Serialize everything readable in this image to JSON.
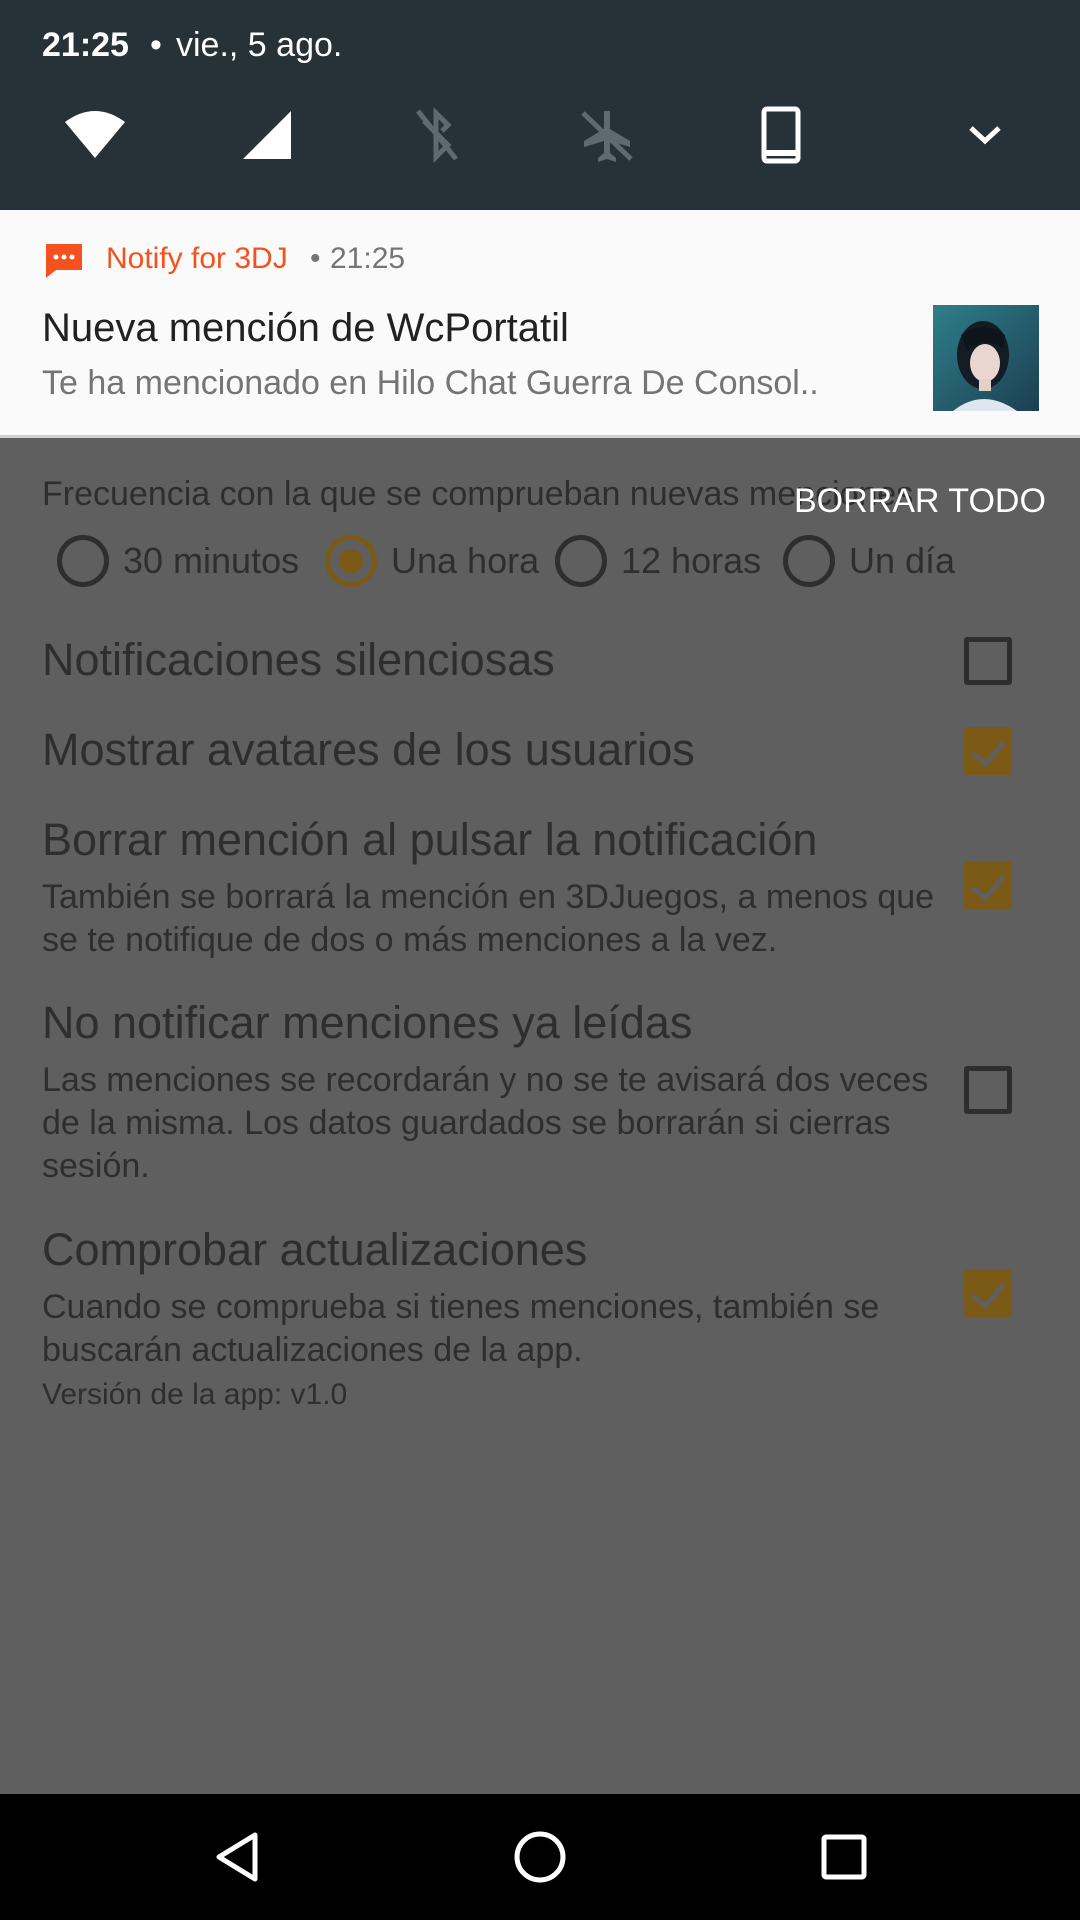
{
  "status": {
    "time": "21:25",
    "separator": "•",
    "date": "vie., 5 ago."
  },
  "quick_settings": {
    "icons": [
      "wifi-icon",
      "cell-signal-icon",
      "bluetooth-off-icon",
      "airplane-off-icon",
      "phone-rotation-icon",
      "expand-chevron-icon"
    ]
  },
  "notification": {
    "app_name": "Notify for 3DJ",
    "separator": "•",
    "time": "21:25",
    "title": "Nueva mención de WcPortatil",
    "text": "Te ha mencionado en Hilo Chat Guerra De Consol..",
    "accent_color": "#f4511e"
  },
  "clear_all_label": "BORRAR TODO",
  "settings": {
    "frequency_label": "Frecuencia con la que se comprueban nuevas menciones",
    "radio_options": [
      {
        "label": "30 minutos",
        "selected": false
      },
      {
        "label": "Una hora",
        "selected": true
      },
      {
        "label": "12 horas",
        "selected": false
      },
      {
        "label": "Un día",
        "selected": false
      }
    ],
    "prefs": [
      {
        "title": "Notificaciones silenciosas",
        "summary": "",
        "checked": false
      },
      {
        "title": "Mostrar avatares de los usuarios",
        "summary": "",
        "checked": true
      },
      {
        "title": "Borrar mención al pulsar la notificación",
        "summary": "También se borrará la mención en 3DJuegos, a menos que se te notifique de dos o más menciones a la vez.",
        "checked": true
      },
      {
        "title": "No notificar menciones ya leídas",
        "summary": "Las menciones se recordarán y no se te avisará dos veces de la misma. Los datos guardados se borrarán si cierras sesión.",
        "checked": false
      },
      {
        "title": "Comprobar actualizaciones",
        "summary": "Cuando se comprueba si tienes menciones, también se buscarán actualizaciones de la app.",
        "checked": true
      }
    ],
    "version": "Versión de la app: v1.0",
    "accent_color": "#7a5a16"
  },
  "nav": {
    "icons": [
      "back-icon",
      "home-icon",
      "recents-icon"
    ]
  }
}
